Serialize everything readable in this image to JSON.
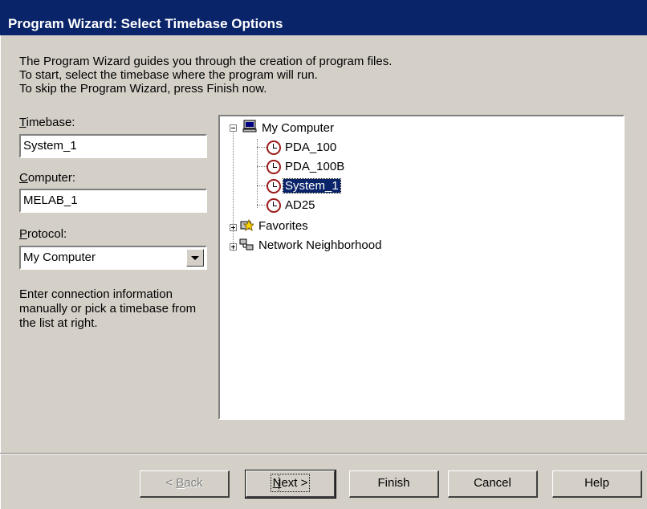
{
  "window": {
    "title": "Program Wizard: Select Timebase Options"
  },
  "intro": {
    "line1": "The Program Wizard guides you through the creation of program files.",
    "line2": "To start, select the timebase where the program will run.",
    "line3": "To skip the Program Wizard, press Finish now."
  },
  "form": {
    "timebase_label_u": "T",
    "timebase_label_rest": "imebase:",
    "timebase_value": "System_1",
    "computer_label_u": "C",
    "computer_label_rest": "omputer:",
    "computer_value": "MELAB_1",
    "protocol_label_u": "P",
    "protocol_label_rest": "rotocol:",
    "protocol_value": "My Computer",
    "help": "Enter connection information manually or pick a timebase from the list at right."
  },
  "tree": {
    "my_computer": "My Computer",
    "items": [
      "PDA_100",
      "PDA_100B",
      "System_1",
      "AD25"
    ],
    "selected": "System_1",
    "favorites": "Favorites",
    "network": "Network Neighborhood"
  },
  "buttons": {
    "back_prefix": "< ",
    "back_u": "B",
    "back_rest": "ack",
    "next_u": "N",
    "next_rest": "ext >",
    "finish": "Finish",
    "cancel": "Cancel",
    "help": "Help"
  },
  "colors": {
    "titlebar": "#0a246a",
    "face": "#d4d0c8",
    "selection": "#0a246a"
  }
}
